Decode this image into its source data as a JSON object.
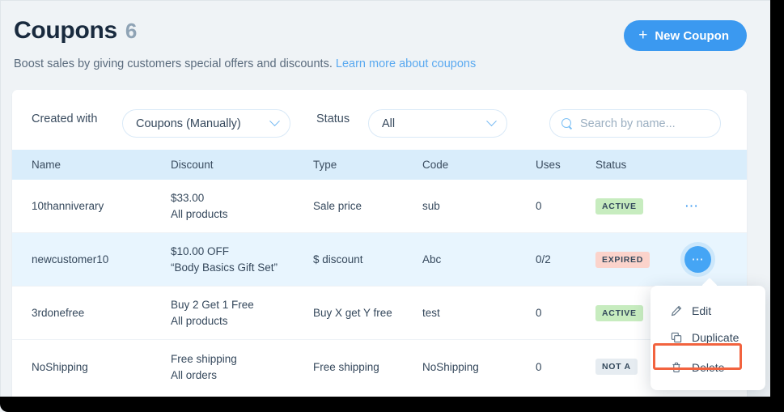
{
  "header": {
    "title": "Coupons",
    "count": "6",
    "subtitle": "Boost sales by giving customers special offers and discounts.",
    "learn_more": "Learn more about coupons",
    "new_coupon_label": "New Coupon",
    "plus_icon": "plus-icon",
    "accent_color": "#3b99f0",
    "link_color": "#5aa9f0"
  },
  "filters": {
    "created_with_label": "Created with",
    "created_with_value": "Coupons (Manually)",
    "status_label": "Status",
    "status_value": "All",
    "search_placeholder": "Search by name...",
    "search_value": "",
    "search_icon": "search-icon",
    "chevron_icon": "chevron-down-icon"
  },
  "table": {
    "columns": [
      "Name",
      "Discount",
      "Type",
      "Code",
      "Uses",
      "Status"
    ],
    "rows": [
      {
        "name": "10thanniverary",
        "discount_amount": "$33.00",
        "discount_scope": "All products",
        "type": "Sale price",
        "code": "sub",
        "uses": "0",
        "status": "ACTIVE",
        "status_kind": "active",
        "menu_open": false
      },
      {
        "name": "newcustomer10",
        "discount_amount": "$10.00 OFF",
        "discount_scope": "“Body Basics Gift Set”",
        "type": "$ discount",
        "code": "Abc",
        "uses": "0/2",
        "status": "EXPIRED",
        "status_kind": "expired",
        "menu_open": true
      },
      {
        "name": "3rdonefree",
        "discount_amount": "Buy 2 Get 1 Free",
        "discount_scope": "All products",
        "type": "Buy X get Y free",
        "code": "test",
        "uses": "0",
        "status": "ACTIVE",
        "status_kind": "active",
        "menu_open": false
      },
      {
        "name": "NoShipping",
        "discount_amount": "Free shipping",
        "discount_scope": "All orders",
        "type": "Free shipping",
        "code": "NoShipping",
        "uses": "0",
        "status": "NOT A",
        "status_kind": "notactive",
        "menu_open": false
      }
    ],
    "row_menu_icon": "ellipsis-icon",
    "header_bg": "#d9edfb",
    "selected_row_bg": "#e8f5fe",
    "badge_active_bg": "#c7ecbf",
    "badge_expired_bg": "#fbd3cb",
    "badge_notactive_bg": "#e6ecf1"
  },
  "action_menu": {
    "items": [
      {
        "label": "Edit",
        "icon": "pencil-icon"
      },
      {
        "label": "Duplicate",
        "icon": "copy-icon"
      },
      {
        "label": "Delete",
        "icon": "trash-icon"
      }
    ],
    "highlight_color": "#f2633f",
    "highlighted_item": "Delete"
  }
}
